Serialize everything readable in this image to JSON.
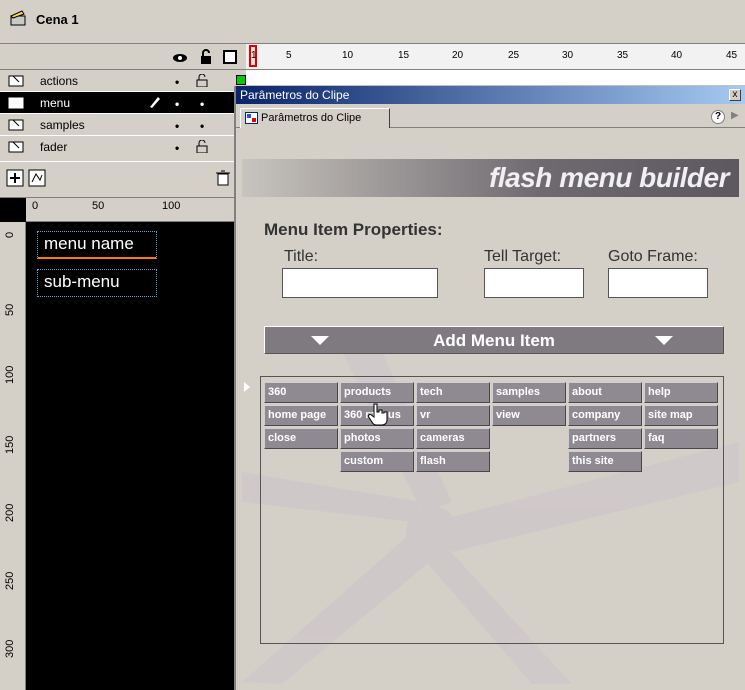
{
  "scene": {
    "title": "Cena 1"
  },
  "timeline": {
    "frame_numbers": [
      "1",
      "5",
      "10",
      "15",
      "20",
      "25",
      "30",
      "35",
      "40",
      "45"
    ],
    "layers": [
      {
        "name": "actions",
        "lock_color": "#00cc00"
      },
      {
        "name": "menu",
        "lock_color": "#1e50ff"
      },
      {
        "name": "samples",
        "lock_color": "#1e50ff"
      },
      {
        "name": "fader",
        "lock_color": "#ff3030"
      }
    ]
  },
  "stage": {
    "ruler_top": [
      "0",
      "50",
      "100"
    ],
    "ruler_left": [
      "0",
      "50",
      "100",
      "150",
      "200",
      "250",
      "300"
    ],
    "items": [
      "menu name",
      "sub-menu"
    ]
  },
  "panel": {
    "title": "Parâmetros do Clipe",
    "tab_label": "Parâmetros do Clipe",
    "close_label": "x",
    "help_label": "?",
    "brand": "flash menu builder",
    "props_heading": "Menu Item Properties:",
    "fields": {
      "title_label": "Title:",
      "tell_target_label": "Tell Target:",
      "goto_frame_label": "Goto Frame:"
    },
    "add_item_label": "Add Menu Item",
    "menu_grid": [
      [
        "360",
        "home page",
        "close"
      ],
      [
        "products",
        "360 menus",
        "photos",
        "custom"
      ],
      [
        "tech",
        "vr",
        "cameras",
        "flash"
      ],
      [
        "samples",
        "view"
      ],
      [
        "about",
        "company",
        "partners",
        "this site"
      ],
      [
        "help",
        "site map",
        "faq"
      ]
    ]
  }
}
